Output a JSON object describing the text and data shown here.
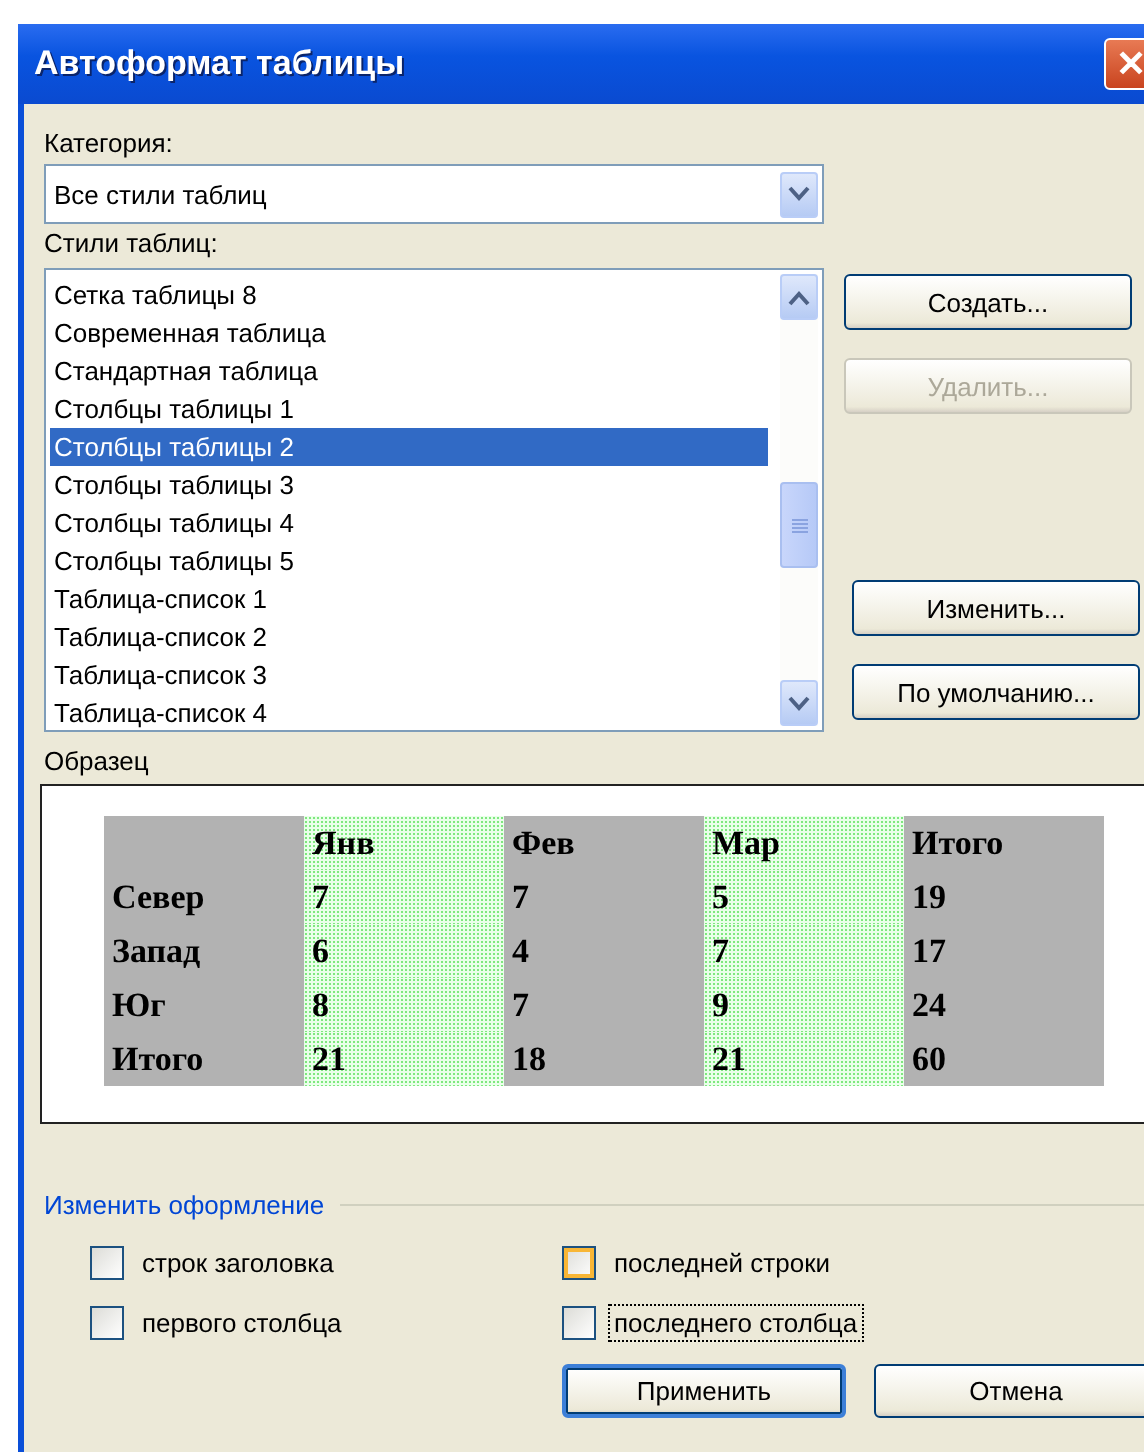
{
  "window": {
    "title": "Автоформат таблицы",
    "close": "✕"
  },
  "category": {
    "label": "Категория:",
    "value": "Все стили таблиц"
  },
  "styles": {
    "label": "Стили таблиц:",
    "items": [
      {
        "label": "Сетка таблицы 8",
        "selected": false
      },
      {
        "label": "Современная таблица",
        "selected": false
      },
      {
        "label": "Стандартная таблица",
        "selected": false
      },
      {
        "label": "Столбцы таблицы 1",
        "selected": false
      },
      {
        "label": "Столбцы таблицы 2",
        "selected": true
      },
      {
        "label": "Столбцы таблицы 3",
        "selected": false
      },
      {
        "label": "Столбцы таблицы 4",
        "selected": false
      },
      {
        "label": "Столбцы таблицы 5",
        "selected": false
      },
      {
        "label": "Таблица-список 1",
        "selected": false
      },
      {
        "label": "Таблица-список 2",
        "selected": false
      },
      {
        "label": "Таблица-список 3",
        "selected": false
      },
      {
        "label": "Таблица-список 4",
        "selected": false
      }
    ]
  },
  "side_buttons": [
    {
      "label": "Создать...",
      "disabled": false
    },
    {
      "label": "Удалить...",
      "disabled": true
    },
    {
      "label": "Изменить...",
      "disabled": false
    },
    {
      "label": "По умолчанию...",
      "disabled": false
    }
  ],
  "preview": {
    "label": "Образец",
    "columns": [
      {
        "kind": "gray"
      },
      {
        "header": "Янв",
        "kind": "dotted"
      },
      {
        "header": "Фев",
        "kind": "gray"
      },
      {
        "header": "Мар",
        "kind": "dotted"
      },
      {
        "header": "Итого",
        "kind": "gray"
      }
    ],
    "rows": [
      {
        "cells": [
          "Север",
          "7",
          "7",
          "5",
          "19"
        ]
      },
      {
        "cells": [
          "Запад",
          "6",
          "4",
          "7",
          "17"
        ]
      },
      {
        "cells": [
          "Юг",
          "8",
          "7",
          "9",
          "24"
        ]
      },
      {
        "cells": [
          "Итого",
          "21",
          "18",
          "21",
          "60"
        ]
      }
    ]
  },
  "apply_to": {
    "title": "Изменить оформление",
    "options": [
      {
        "label": "строк заголовка",
        "checked": false,
        "hot": false,
        "focused": false
      },
      {
        "label": "последней строки",
        "checked": false,
        "hot": true,
        "focused": false
      },
      {
        "label": "первого столбца",
        "checked": false,
        "hot": false,
        "focused": false
      },
      {
        "label": "последнего столбца",
        "checked": false,
        "hot": false,
        "focused": true
      }
    ]
  },
  "buttons": [
    {
      "label": "Применить",
      "default": true
    },
    {
      "label": "Отмена",
      "default": false
    }
  ]
}
